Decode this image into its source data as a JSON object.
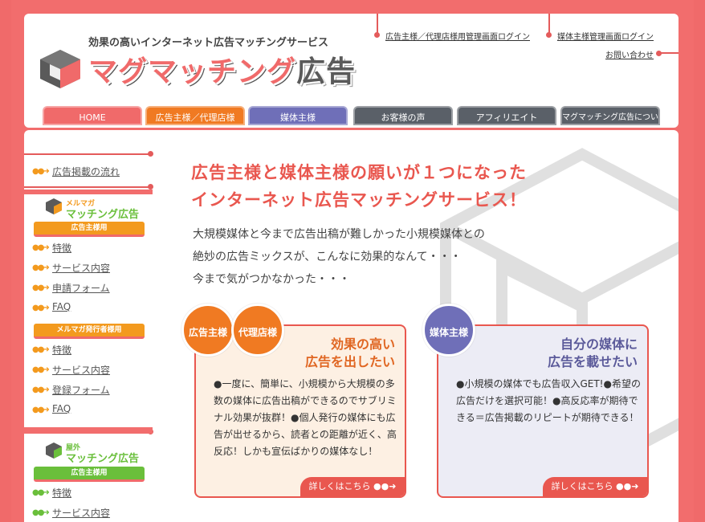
{
  "header": {
    "tagline": "効果の高いインターネット広告マッチングサービス",
    "logo_main": "マグマッチング",
    "logo_suffix": "広告",
    "links": {
      "advertiser_login": "広告主様／代理店様用管理画面ログイン",
      "media_login": "媒体主様管理画面ログイン",
      "contact": "お問い合わせ"
    }
  },
  "nav": [
    {
      "label": "HOME",
      "color": "#f06a6a"
    },
    {
      "label": "広告主様／代理店様",
      "color": "#f07a22"
    },
    {
      "label": "媒体主様",
      "color": "#6f6fb8"
    },
    {
      "label": "お客様の声",
      "color": "#5a6068"
    },
    {
      "label": "アフィリエイト",
      "color": "#5a6068"
    },
    {
      "label": "マグマッチング広告について",
      "color": "#5a6068"
    }
  ],
  "sidebar": {
    "flow_link": "広告掲載の流れ",
    "mag": {
      "logo_top": "メルマガ",
      "logo_main": "マッチング広告",
      "adv_label": "広告主様用",
      "adv_items": [
        "特徴",
        "サービス内容",
        "申請フォーム",
        "FAQ"
      ],
      "pub_label": "メルマガ発行者様用",
      "pub_items": [
        "特徴",
        "サービス内容",
        "登録フォーム",
        "FAQ"
      ]
    },
    "outdoor": {
      "logo_top": "屋外",
      "logo_main": "マッチング広告",
      "adv_label": "広告主様用",
      "adv_items": [
        "特徴",
        "サービス内容"
      ]
    }
  },
  "main": {
    "headline_1": "広告主様と媒体主様の願いが１つになった",
    "headline_2": "インターネット広告マッチングサービス！",
    "lead_1": "大規模媒体と今まで広告出稿が難しかった小規模媒体との",
    "lead_2": "絶妙の広告ミックスが、こんなに効果的なんて・・・",
    "lead_3": "今まで気がつかなかった・・・",
    "card_adv": {
      "badge_1": "広告主様",
      "badge_2": "代理店様",
      "title_1": "効果の高い",
      "title_2": "広告を出したい",
      "body": "●一度に、簡単に、小規模から大規模の多数の媒体に広告出稿ができるのでサブリミナル効果が抜群！●個人発行の媒体にも広告が出せるから、読者との距離が近く、高反応！しかも宣伝ばかりの媒体なし！",
      "button": "詳しくはこちら"
    },
    "card_media": {
      "badge": "媒体主様",
      "title_1": "自分の媒体に",
      "title_2": "広告を載せたい",
      "body": "●小規模の媒体でも広告収入GET!●希望の広告だけを選択可能！●高反応率が期待できる＝広告掲載のリピートが期待できる！",
      "button": "詳しくはこちら"
    }
  },
  "colors": {
    "accent": "#f06a6a",
    "orange": "#f07a22",
    "blue": "#6f6fb8",
    "dark": "#5a6068",
    "green": "#6abf3b"
  }
}
